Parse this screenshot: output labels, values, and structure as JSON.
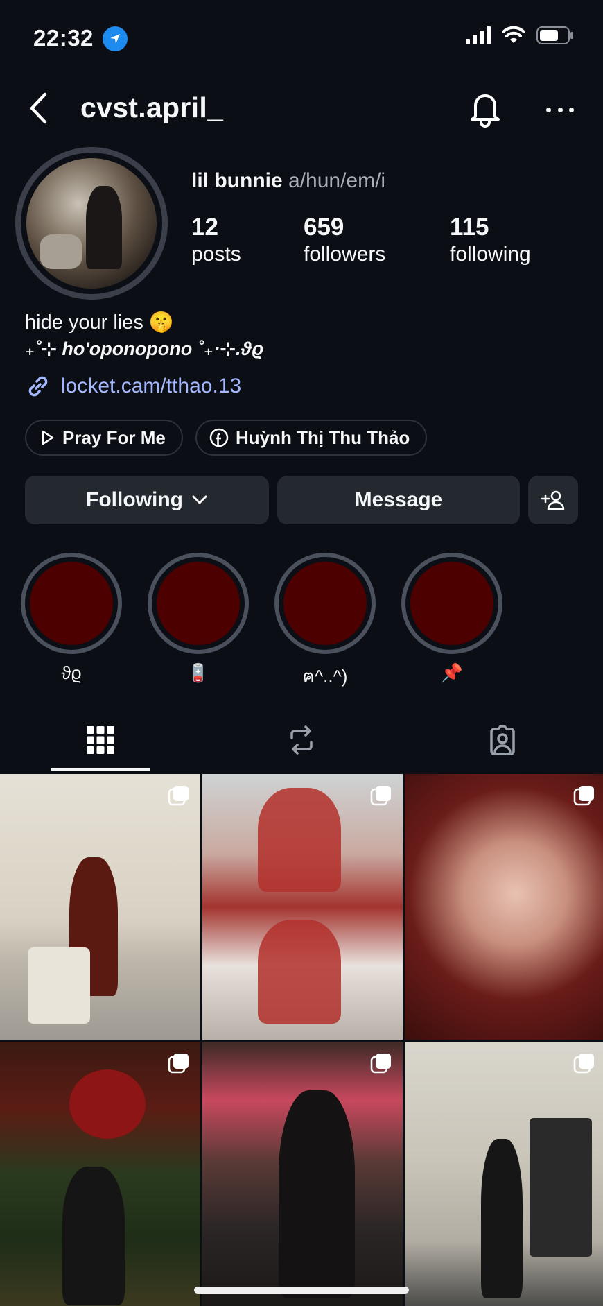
{
  "status_bar": {
    "time": "22:32"
  },
  "header": {
    "username": "cvst.april_"
  },
  "profile": {
    "display_name": "lil bunnie",
    "pronouns": "a/hun/em/i",
    "stats": {
      "posts": {
        "value": "12",
        "label": "posts"
      },
      "followers": {
        "value": "659",
        "label": "followers"
      },
      "following": {
        "value": "115",
        "label": "following"
      }
    },
    "bio_line1": "hide your lies 🤫",
    "bio_line2": "₊˚⊹ ho'oponopono ˚₊‧⊹.ϑϱ",
    "link": "locket.cam/tthao.13"
  },
  "chips": [
    {
      "label": "Pray For Me",
      "icon": "play-icon"
    },
    {
      "label": "Huỳnh Thị Thu Thảo",
      "icon": "facebook-icon"
    }
  ],
  "actions": {
    "following_label": "Following",
    "message_label": "Message"
  },
  "highlights": [
    {
      "label": "ϑϱ"
    },
    {
      "label": "🪫"
    },
    {
      "label": "ฅ^..^)"
    },
    {
      "label": "📌"
    }
  ],
  "tabs": [
    "grid-icon",
    "reels-repost-icon",
    "tagged-icon"
  ],
  "colors": {
    "background": "#0b0e14",
    "button": "#24282f",
    "link": "#a5b8ff",
    "highlight_fill": "#4d0000"
  }
}
